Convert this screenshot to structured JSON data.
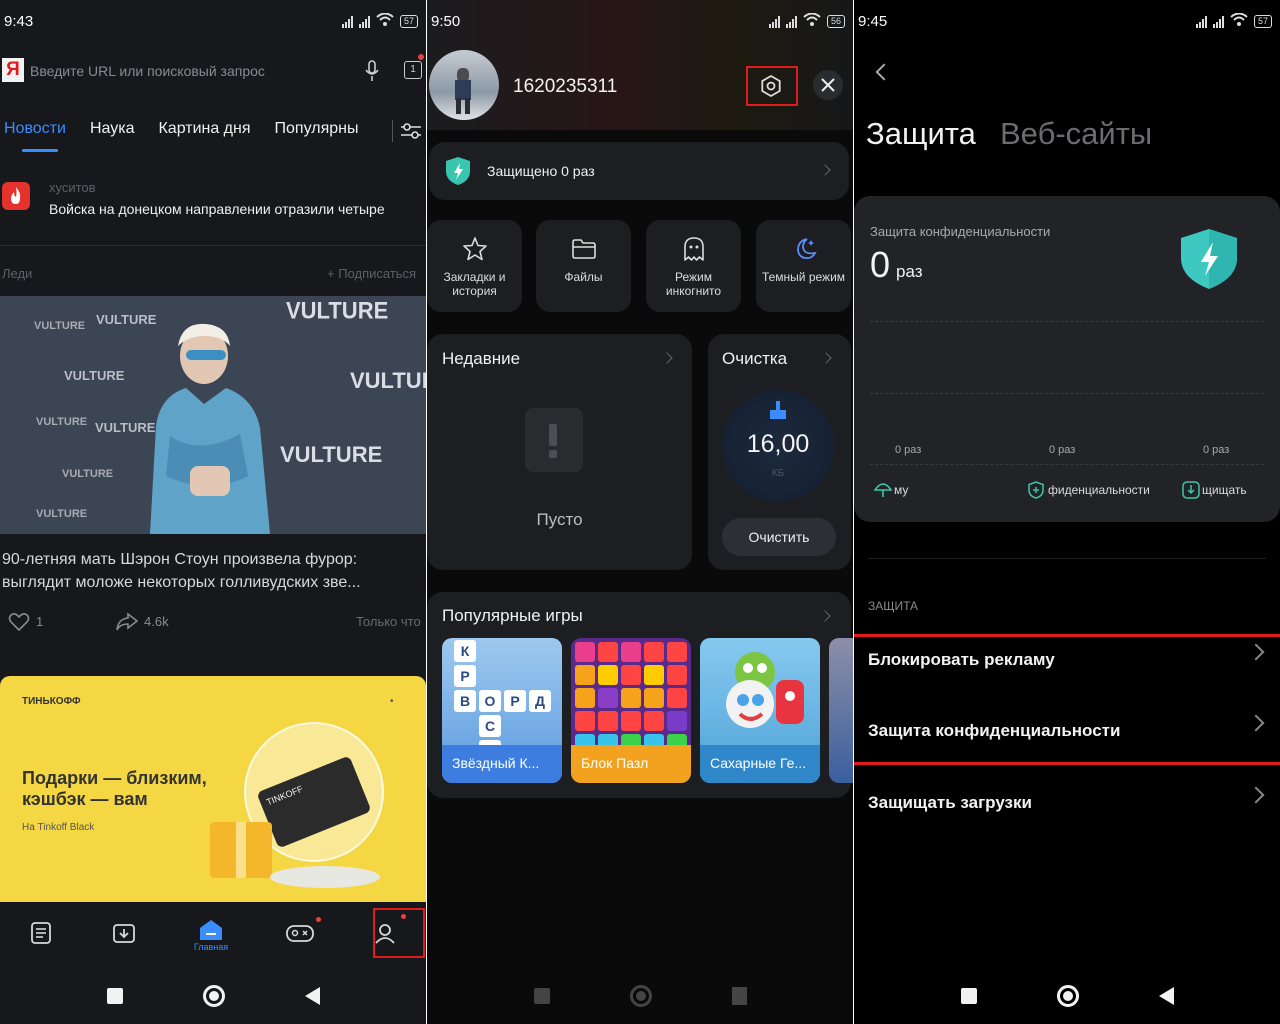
{
  "status_p1": {
    "time": "9:43",
    "battery": "57"
  },
  "status_p2": {
    "time": "9:50",
    "battery": "56"
  },
  "status_p3": {
    "time": "9:45",
    "battery": "57"
  },
  "p1": {
    "search_placeholder": "Введите URL или поисковый запрос",
    "tab_count": "1",
    "tabs": [
      "Новости",
      "Наука",
      "Картина дня",
      "Популярны"
    ],
    "news1": {
      "source": "хуситов",
      "title": "Войска на донецком направлении отразили четыре"
    },
    "feed_channel": "Леди",
    "subscribe": "+ Подписаться",
    "article_title": "90-летняя мать Шэрон Стоун произвела фурор: выглядит моложе некоторых голливудских зве...",
    "likes": "1",
    "shares": "4.6k",
    "time_ago": "Только что",
    "photo_banner_words": [
      "VULTURE",
      "VULTURE",
      "VULTURE",
      "VULTURE",
      "VULTURE"
    ],
    "ad": {
      "brand": "ТИНЬКОФФ",
      "headline": "Подарки — близким, кэшбэк — вам",
      "sub": "На Tinkoff Black",
      "card_text": "TINKOFF"
    },
    "bottom_nav_home": "Главная"
  },
  "p2": {
    "user_id": "1620235311",
    "protected": "Защищено 0 раз",
    "tiles": [
      {
        "label": "Закладки и история",
        "icon": "star-icon"
      },
      {
        "label": "Файлы",
        "icon": "folder-icon"
      },
      {
        "label": "Режим инкогнито",
        "icon": "ghost-icon"
      },
      {
        "label": "Темный режим",
        "icon": "moon-icon"
      }
    ],
    "recent_title": "Недавние",
    "recent_empty": "Пусто",
    "clean_title": "Очистка",
    "clean_value": "16,00",
    "clean_unit": "КБ",
    "clean_button": "Очистить",
    "games_title": "Популярные игры",
    "games": [
      "Звёздный К...",
      "Блок Пазл",
      "Сахарные Ге..."
    ],
    "game1_letters": [
      "К",
      "Р",
      "В",
      "О",
      "Р",
      "Д",
      "С",
      "С"
    ]
  },
  "p3": {
    "tab_active": "Защита",
    "tab_inactive": "Веб-сайты",
    "card_title": "Защита конфиденциальности",
    "count": "0",
    "count_unit": "раз",
    "axis_labels": [
      "0 раз",
      "0 раз",
      "0 раз"
    ],
    "legend": [
      "му",
      "фиденциальности",
      "щищать"
    ],
    "section": "ЗАЩИТА",
    "rows": [
      "Блокировать рекламу",
      "Защита конфиденциальности",
      "Защищать загрузки"
    ]
  }
}
